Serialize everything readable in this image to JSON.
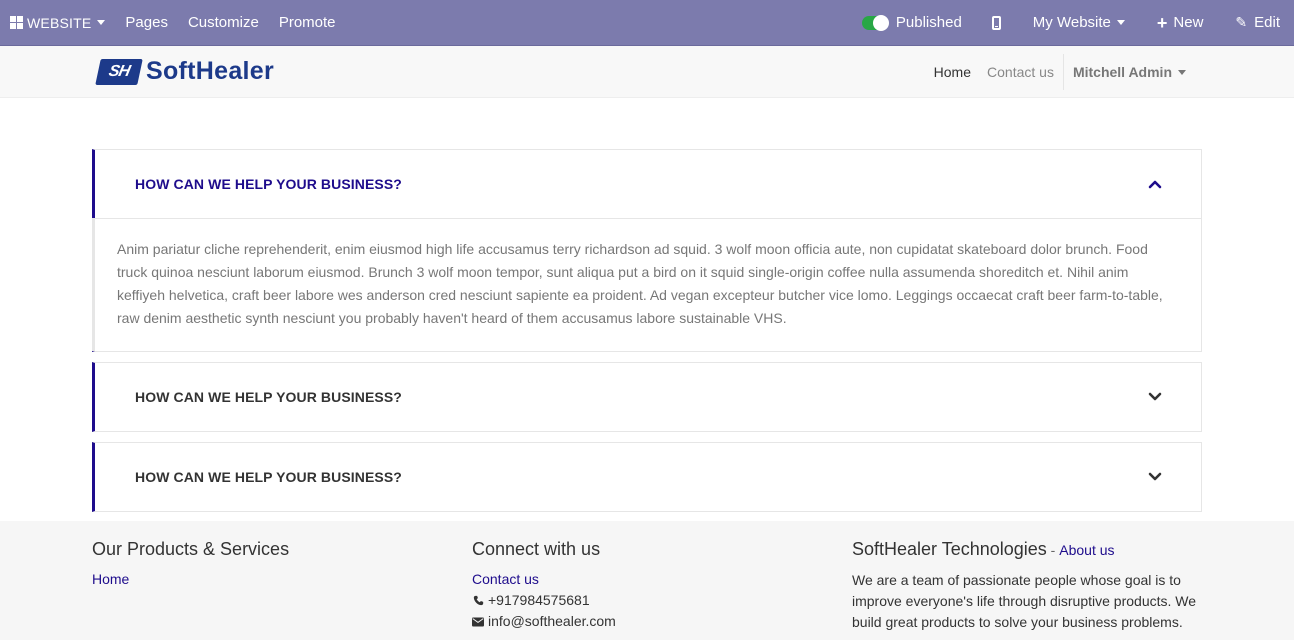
{
  "topbar": {
    "website_label": "WEBSITE",
    "menu_items": [
      "Pages",
      "Customize",
      "Promote"
    ],
    "published_label": "Published",
    "my_website_label": "My Website",
    "new_label": "New",
    "edit_label": "Edit",
    "published": true
  },
  "header": {
    "logo_mark": "SH",
    "logo_text": "SoftHealer",
    "nav": [
      "Home",
      "Contact us"
    ],
    "user": "Mitchell Admin"
  },
  "faq": [
    {
      "title": "HOW CAN WE HELP YOUR BUSINESS?",
      "open": true,
      "body": "Anim pariatur cliche reprehenderit, enim eiusmod high life accusamus terry richardson ad squid. 3 wolf moon officia aute, non cupidatat skateboard dolor brunch. Food truck quinoa nesciunt laborum eiusmod. Brunch 3 wolf moon tempor, sunt aliqua put a bird on it squid single-origin coffee nulla assumenda shoreditch et. Nihil anim keffiyeh helvetica, craft beer labore wes anderson cred nesciunt sapiente ea proident. Ad vegan excepteur butcher vice lomo. Leggings occaecat craft beer farm-to-table, raw denim aesthetic synth nesciunt you probably haven't heard of them accusamus labore sustainable VHS."
    },
    {
      "title": "HOW CAN WE HELP YOUR BUSINESS?",
      "open": false
    },
    {
      "title": "HOW CAN WE HELP YOUR BUSINESS?",
      "open": false
    }
  ],
  "footer": {
    "products": {
      "title": "Our Products & Services",
      "link": "Home"
    },
    "connect": {
      "title": "Connect with us",
      "link": "Contact us",
      "phone": "+917984575681",
      "email": "info@softhealer.com"
    },
    "about": {
      "title": "SoftHealer Technologies",
      "separator": " - ",
      "link": "About us",
      "text": "We are a team of passionate people whose goal is to improve everyone's life through disruptive products. We build great products to solve your business problems."
    }
  },
  "colors": {
    "topbar": "#7c7bad",
    "accent": "#1e0c8c",
    "toggle_on": "#28a745",
    "logo": "#1d3a8a"
  }
}
